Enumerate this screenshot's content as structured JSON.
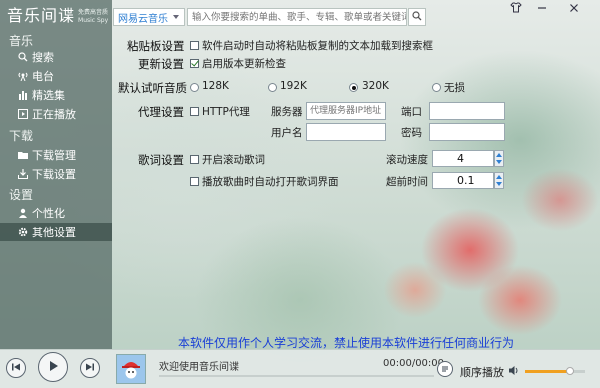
{
  "app": {
    "title": "音乐间谍",
    "subtitle_cn": "免费高音质",
    "subtitle_en": "Music Spy"
  },
  "search": {
    "source": "网易云音乐",
    "placeholder": "输入你要搜索的单曲、歌手、专辑、歌单或者关键词"
  },
  "sidebar": {
    "sections": [
      {
        "label": "音乐",
        "items": [
          {
            "label": "搜索",
            "icon": "search-icon"
          },
          {
            "label": "电台",
            "icon": "radio-icon"
          },
          {
            "label": "精选集",
            "icon": "chart-bars-icon"
          },
          {
            "label": "正在播放",
            "icon": "play-box-icon"
          }
        ]
      },
      {
        "label": "下载",
        "items": [
          {
            "label": "下载管理",
            "icon": "folder-icon"
          },
          {
            "label": "下载设置",
            "icon": "download-tray-icon"
          }
        ]
      },
      {
        "label": "设置",
        "items": [
          {
            "label": "个性化",
            "icon": "person-icon"
          },
          {
            "label": "其他设置",
            "icon": "gear-icon",
            "active": true
          }
        ]
      }
    ]
  },
  "settings": {
    "clipboard_label": "粘贴板设置",
    "clipboard_option": "软件启动时自动将粘贴板复制的文本加载到搜索框",
    "clipboard_checked": false,
    "update_label": "更新设置",
    "update_option": "启用版本更新检查",
    "update_checked": true,
    "quality_label": "默认试听音质",
    "quality_options": [
      "128K",
      "192K",
      "320K",
      "无损"
    ],
    "quality_selected": "320K",
    "proxy_label": "代理设置",
    "proxy_option": "HTTP代理",
    "proxy_checked": false,
    "server_label": "服务器",
    "server_placeholder": "代理服务器IP地址",
    "port_label": "端口",
    "username_label": "用户名",
    "password_label": "密码",
    "lyrics_label": "歌词设置",
    "lyrics_scroll_option": "开启滚动歌词",
    "lyrics_scroll_checked": false,
    "lyrics_auto_option": "播放歌曲时自动打开歌词界面",
    "lyrics_auto_checked": false,
    "scroll_speed_label": "滚动速度",
    "scroll_speed_value": "4",
    "advance_time_label": "超前时间",
    "advance_time_value": "0.1"
  },
  "disclaimer": "本软件仅用作个人学习交流，禁止使用本软件进行任何商业行为",
  "player": {
    "song_title": "欢迎使用音乐间谍",
    "time": "00:00/00:00",
    "mode": "顺序播放",
    "progress": 0,
    "volume": 0.75
  },
  "colors": {
    "accent": "#2f7fd2",
    "disclaimer": "#1a3fd6",
    "volume": "#f0a020"
  }
}
